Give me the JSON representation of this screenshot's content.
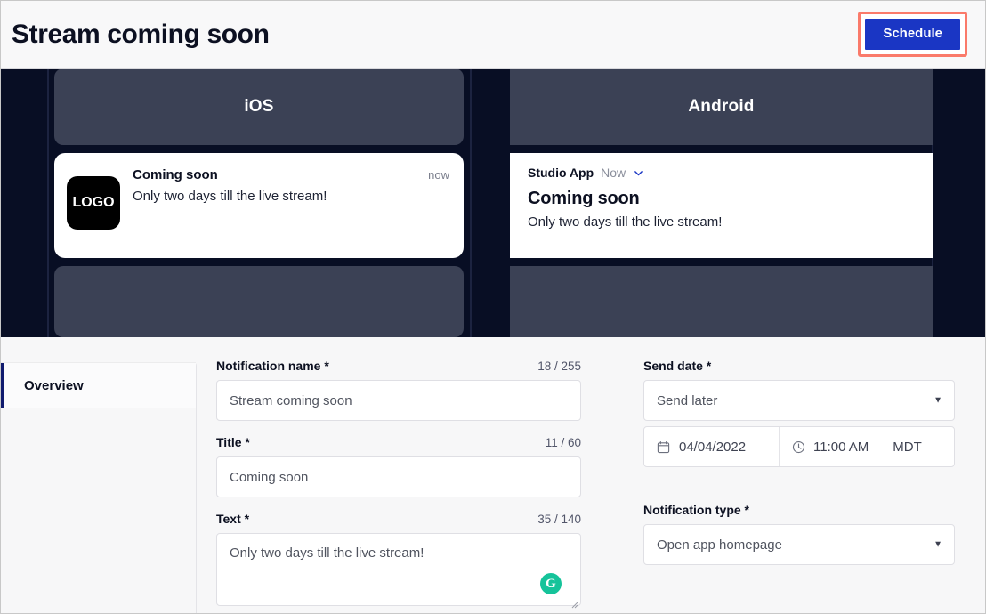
{
  "header": {
    "title": "Stream coming soon",
    "schedule_label": "Schedule"
  },
  "preview": {
    "ios": {
      "os_name": "iOS",
      "logo_text": "LOGO",
      "title": "Coming soon",
      "time": "now",
      "body": "Only two days till the live stream!"
    },
    "android": {
      "os_name": "Android",
      "app_name": "Studio App",
      "time": "Now",
      "title": "Coming soon",
      "body": "Only two days till the live stream!"
    }
  },
  "sidebar": {
    "items": [
      {
        "label": "Overview"
      }
    ]
  },
  "form": {
    "notification_name": {
      "label": "Notification name *",
      "count": "18 / 255",
      "value": "Stream coming soon"
    },
    "title": {
      "label": "Title *",
      "count": "11 / 60",
      "value": "Coming soon"
    },
    "text": {
      "label": "Text *",
      "count": "35 / 140",
      "value": "Only two days till the live stream!",
      "assistant_icon_letter": "G"
    },
    "send_date": {
      "label": "Send date *",
      "mode_value": "Send later",
      "date_value": "04/04/2022",
      "time_value": "11:00 AM",
      "timezone": "MDT"
    },
    "notification_type": {
      "label": "Notification type *",
      "value": "Open app homepage"
    }
  },
  "colors": {
    "accent_blue": "#1a36c4",
    "highlight_red": "#fa7a6a",
    "preview_bg": "#080e24",
    "panel_gray": "#3b4155",
    "sidebar_active_bar": "#101a6e",
    "grammarly_green": "#15c39a"
  }
}
